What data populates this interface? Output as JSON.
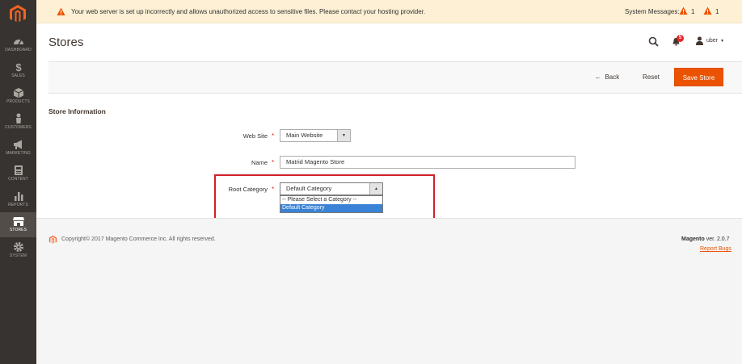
{
  "sidebar": {
    "items": [
      {
        "label": "DASHBOARD",
        "icon": "dashboard-icon"
      },
      {
        "label": "SALES",
        "icon": "dollar-icon"
      },
      {
        "label": "PRODUCTS",
        "icon": "cube-icon"
      },
      {
        "label": "CUSTOMERS",
        "icon": "person-icon"
      },
      {
        "label": "MARKETING",
        "icon": "megaphone-icon"
      },
      {
        "label": "CONTENT",
        "icon": "content-icon"
      },
      {
        "label": "REPORTS",
        "icon": "bar-chart-icon"
      },
      {
        "label": "STORES",
        "icon": "store-icon",
        "active": true
      },
      {
        "label": "SYSTEM",
        "icon": "gear-icon"
      }
    ]
  },
  "message_bar": {
    "text": "Your web server is set up incorrectly and allows unauthorized access to sensitive files. Please contact your hosting provider.",
    "system_messages_label": "System Messages:",
    "count_1": "1",
    "count_2": "1"
  },
  "header": {
    "title": "Stores",
    "notification_count": "5",
    "user_name": "uber"
  },
  "actions": {
    "back_label": "Back",
    "reset_label": "Reset",
    "save_label": "Save Store"
  },
  "form": {
    "section_title": "Store Information",
    "website_label": "Web Site",
    "website_value": "Main Website",
    "name_label": "Name",
    "name_value": "Matrid Magento Store",
    "root_category_label": "Root Category",
    "root_category_value": "Default Category",
    "root_category_options": [
      "-- Please Select a Category --",
      "Default Category"
    ]
  },
  "footer": {
    "copyright": "Copyright© 2017 Magento Commerce Inc. All rights reserved.",
    "brand": "Magento",
    "version": "ver. 2.0.7",
    "report_bugs": "Report Bugs"
  },
  "colors": {
    "accent": "#eb5202",
    "sidebar_bg": "#373330",
    "message_bg": "#fdf0d5",
    "highlight": "#d0202a",
    "selected_option": "#3a82d5"
  }
}
